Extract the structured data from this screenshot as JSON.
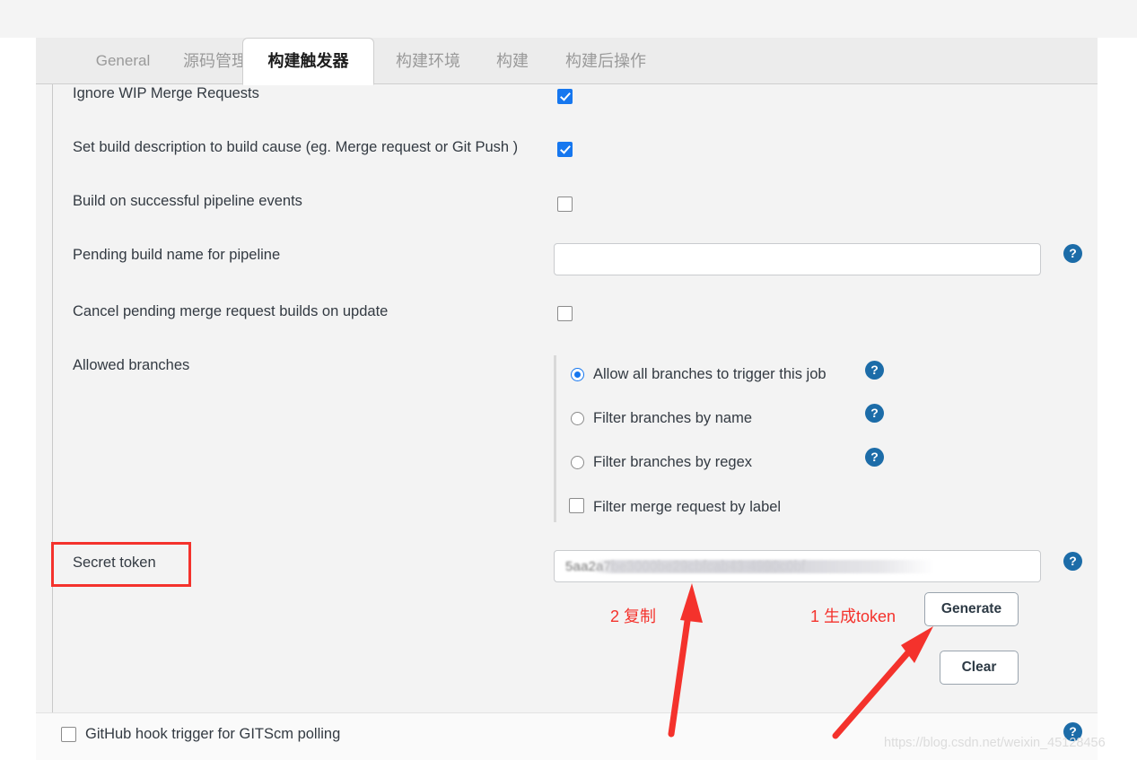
{
  "tabs": [
    {
      "label": "General",
      "active": false
    },
    {
      "label": "源码管理",
      "active": false
    },
    {
      "label": "构建触发器",
      "active": true
    },
    {
      "label": "构建环境",
      "active": false
    },
    {
      "label": "构建",
      "active": false
    },
    {
      "label": "构建后操作",
      "active": false
    }
  ],
  "form": {
    "rows": [
      {
        "label": "Ignore WIP Merge Requests",
        "control": "checkbox",
        "checked": true
      },
      {
        "label": "Set build description to build cause (eg. Merge request or Git Push )",
        "control": "checkbox",
        "checked": true
      },
      {
        "label": "Build on successful pipeline events",
        "control": "checkbox",
        "checked": false
      },
      {
        "label": "Pending build name for pipeline",
        "control": "text",
        "value": "",
        "placeholder": ""
      },
      {
        "label": "Cancel pending merge request builds on update",
        "control": "checkbox",
        "checked": false
      },
      {
        "label": "Allowed branches",
        "control": "radiogroup"
      },
      {
        "label": "Secret token",
        "control": "token"
      }
    ],
    "allowed_branches": {
      "options": [
        {
          "label": "Allow all branches to trigger this job",
          "type": "radio",
          "selected": true
        },
        {
          "label": "Filter branches by name",
          "type": "radio",
          "selected": false
        },
        {
          "label": "Filter branches by regex",
          "type": "radio",
          "selected": false
        },
        {
          "label": "Filter merge request by label",
          "type": "checkbox",
          "checked": false
        }
      ]
    },
    "secret_token": {
      "value": "5aa2a7be3000be29cbfcab43-4990c0bf",
      "generate_label": "Generate",
      "clear_label": "Clear"
    },
    "github_hook": {
      "label": "GitHub hook trigger for GITScm polling",
      "checked": false
    },
    "help_icon": "?"
  },
  "annotations": [
    {
      "id": "copy-step",
      "text": "2 复制",
      "color": "#f4322c"
    },
    {
      "id": "generate-step",
      "text": "1 生成token",
      "color": "#f4322c"
    }
  ],
  "watermark": "https://blog.csdn.net/weixin_45128456"
}
